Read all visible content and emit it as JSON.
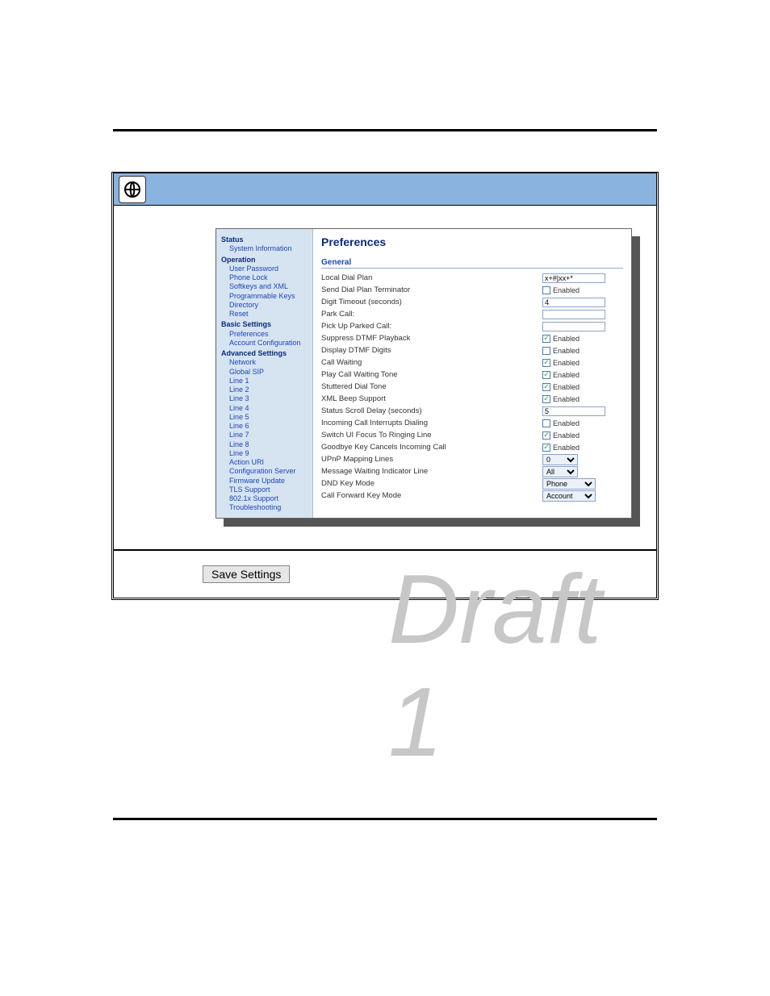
{
  "page": {
    "save_label": "Save Settings"
  },
  "sidebar": {
    "groups": [
      {
        "header": "Status",
        "items": [
          "System Information"
        ]
      },
      {
        "header": "Operation",
        "items": [
          "User Password",
          "Phone Lock",
          "Softkeys and XML",
          "Programmable Keys",
          "Directory",
          "Reset"
        ]
      },
      {
        "header": "Basic Settings",
        "items": [
          "Preferences",
          "Account Configuration"
        ]
      },
      {
        "header": "Advanced Settings",
        "items": [
          "Network",
          "Global SIP",
          "Line 1",
          "Line 2",
          "Line 3",
          "Line 4",
          "Line 5",
          "Line 6",
          "Line 7",
          "Line 8",
          "Line 9",
          "Action URI",
          "Configuration Server",
          "Firmware Update",
          "TLS Support",
          "802.1x Support",
          "Troubleshooting"
        ]
      }
    ]
  },
  "main": {
    "title": "Preferences",
    "section": "General",
    "rows": [
      {
        "label": "Local Dial Plan",
        "type": "text",
        "value": "x+#|xx+*"
      },
      {
        "label": "Send Dial Plan Terminator",
        "type": "check",
        "checked": false,
        "text": "Enabled"
      },
      {
        "label": "Digit Timeout (seconds)",
        "type": "text",
        "value": "4"
      },
      {
        "label": "Park Call:",
        "type": "text",
        "value": ""
      },
      {
        "label": "Pick Up Parked Call:",
        "type": "text",
        "value": ""
      },
      {
        "label": "Suppress DTMF Playback",
        "type": "check",
        "checked": true,
        "text": "Enabled"
      },
      {
        "label": "Display DTMF Digits",
        "type": "check",
        "checked": false,
        "text": "Enabled"
      },
      {
        "label": "Call Waiting",
        "type": "check",
        "checked": true,
        "text": "Enabled"
      },
      {
        "label": "Play Call Waiting Tone",
        "type": "check",
        "checked": true,
        "text": "Enabled"
      },
      {
        "label": "Stuttered Dial Tone",
        "type": "check",
        "checked": true,
        "text": "Enabled"
      },
      {
        "label": "XML Beep Support",
        "type": "check",
        "checked": true,
        "text": "Enabled"
      },
      {
        "label": "Status Scroll Delay (seconds)",
        "type": "text",
        "value": "5"
      },
      {
        "label": "Incoming Call Interrupts Dialing",
        "type": "check",
        "checked": false,
        "text": "Enabled"
      },
      {
        "label": "Switch UI Focus To Ringing Line",
        "type": "check",
        "checked": true,
        "text": "Enabled"
      },
      {
        "label": "Goodbye Key Cancels Incoming Call",
        "type": "check",
        "checked": true,
        "text": "Enabled"
      },
      {
        "label": "UPnP Mapping Lines",
        "type": "select",
        "value": "0"
      },
      {
        "label": "Message Waiting Indicator Line",
        "type": "select",
        "value": "All"
      },
      {
        "label": "DND Key Mode",
        "type": "select",
        "value": "Phone"
      },
      {
        "label": "Call Forward Key Mode",
        "type": "select",
        "value": "Account"
      }
    ]
  },
  "watermark": "Draft 1"
}
